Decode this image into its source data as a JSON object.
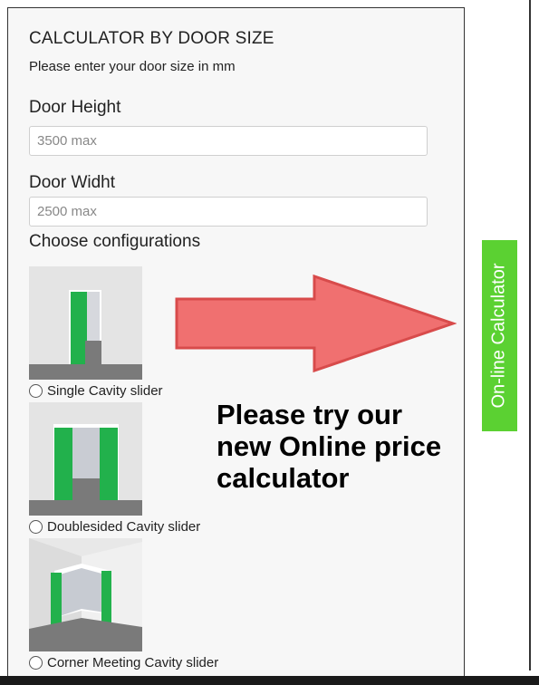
{
  "form": {
    "title": "CALCULATOR BY DOOR SIZE",
    "subtitle": "Please enter your door size in mm",
    "height": {
      "label": "Door Height",
      "placeholder": "3500 max"
    },
    "width": {
      "label": "Door  Widht",
      "placeholder": "2500 max"
    },
    "section_label": "Choose configurations",
    "configurations": [
      {
        "label": "Single Cavity slider"
      },
      {
        "label": "Doublesided Cavity slider"
      },
      {
        "label": "Corner Meeting Cavity slider"
      }
    ]
  },
  "promo": {
    "lines": [
      "Please try our",
      "new Online price",
      "calculator"
    ]
  },
  "side_tab": {
    "label": "On-line Calculator"
  },
  "colors": {
    "arrow_fill": "#f07070",
    "arrow_stroke": "#d84b4b",
    "tab_green": "#5bd132",
    "door_green": "#22b14c",
    "floor_grey": "#7a7a7a"
  },
  "icons": [
    "radio-icon",
    "arrow-icon"
  ]
}
